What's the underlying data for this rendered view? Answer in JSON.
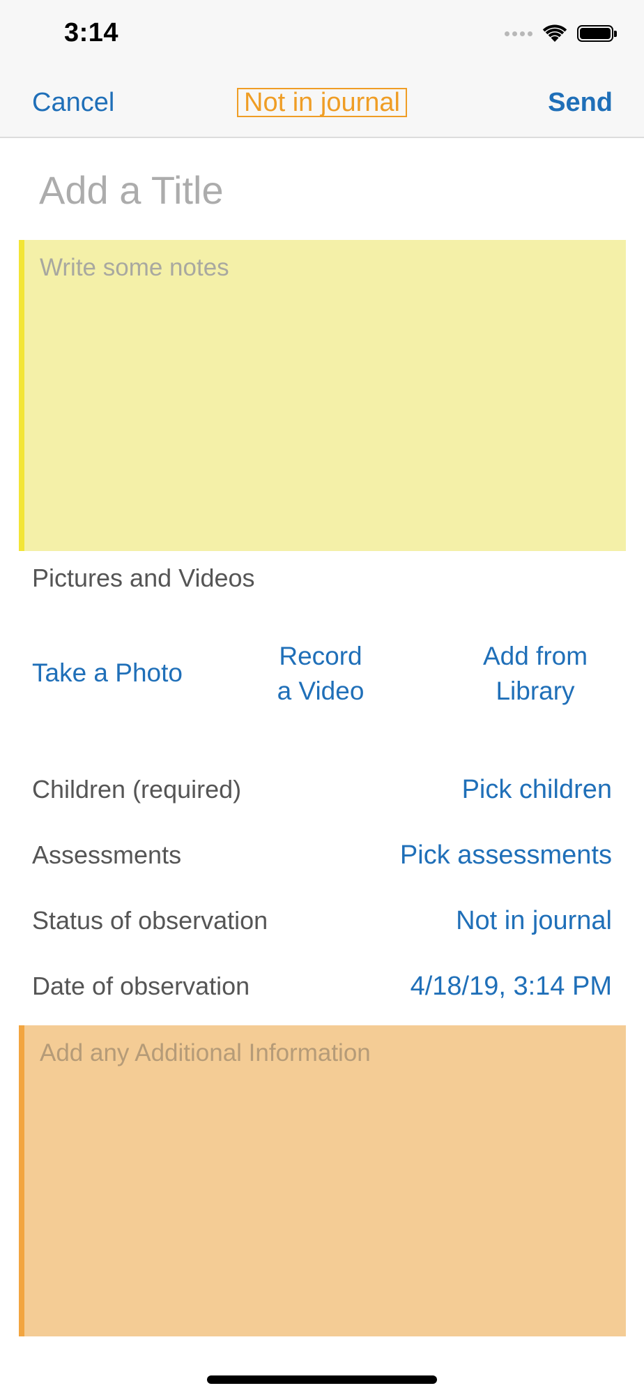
{
  "status_bar": {
    "time": "3:14"
  },
  "nav": {
    "cancel_label": "Cancel",
    "status_label": "Not in journal",
    "send_label": "Send"
  },
  "title_field": {
    "value": "",
    "placeholder": "Add a Title"
  },
  "notes_field": {
    "value": "",
    "placeholder": "Write some notes"
  },
  "media": {
    "section_label": "Pictures and Videos",
    "take_photo_label": "Take a Photo",
    "record_video_line1": "Record",
    "record_video_line2": "a Video",
    "add_library_line1": "Add from",
    "add_library_line2": "Library"
  },
  "details": {
    "children_label": "Children (required)",
    "children_value": "Pick children",
    "assessments_label": "Assessments",
    "assessments_value": "Pick assessments",
    "status_label": "Status of observation",
    "status_value": "Not in journal",
    "date_label": "Date of observation",
    "date_value": "4/18/19, 3:14 PM"
  },
  "additional_field": {
    "value": "",
    "placeholder": "Add any Additional Information"
  },
  "colors": {
    "accent_blue": "#1f6fb8",
    "status_orange": "#ef9d25",
    "notes_bg": "#f4f0a8",
    "notes_border": "#f2e536",
    "info_bg": "#f4cc95",
    "info_border": "#f2a540"
  },
  "icons": {
    "signal": "cellular-signal-icon",
    "wifi": "wifi-icon",
    "battery": "battery-icon"
  }
}
